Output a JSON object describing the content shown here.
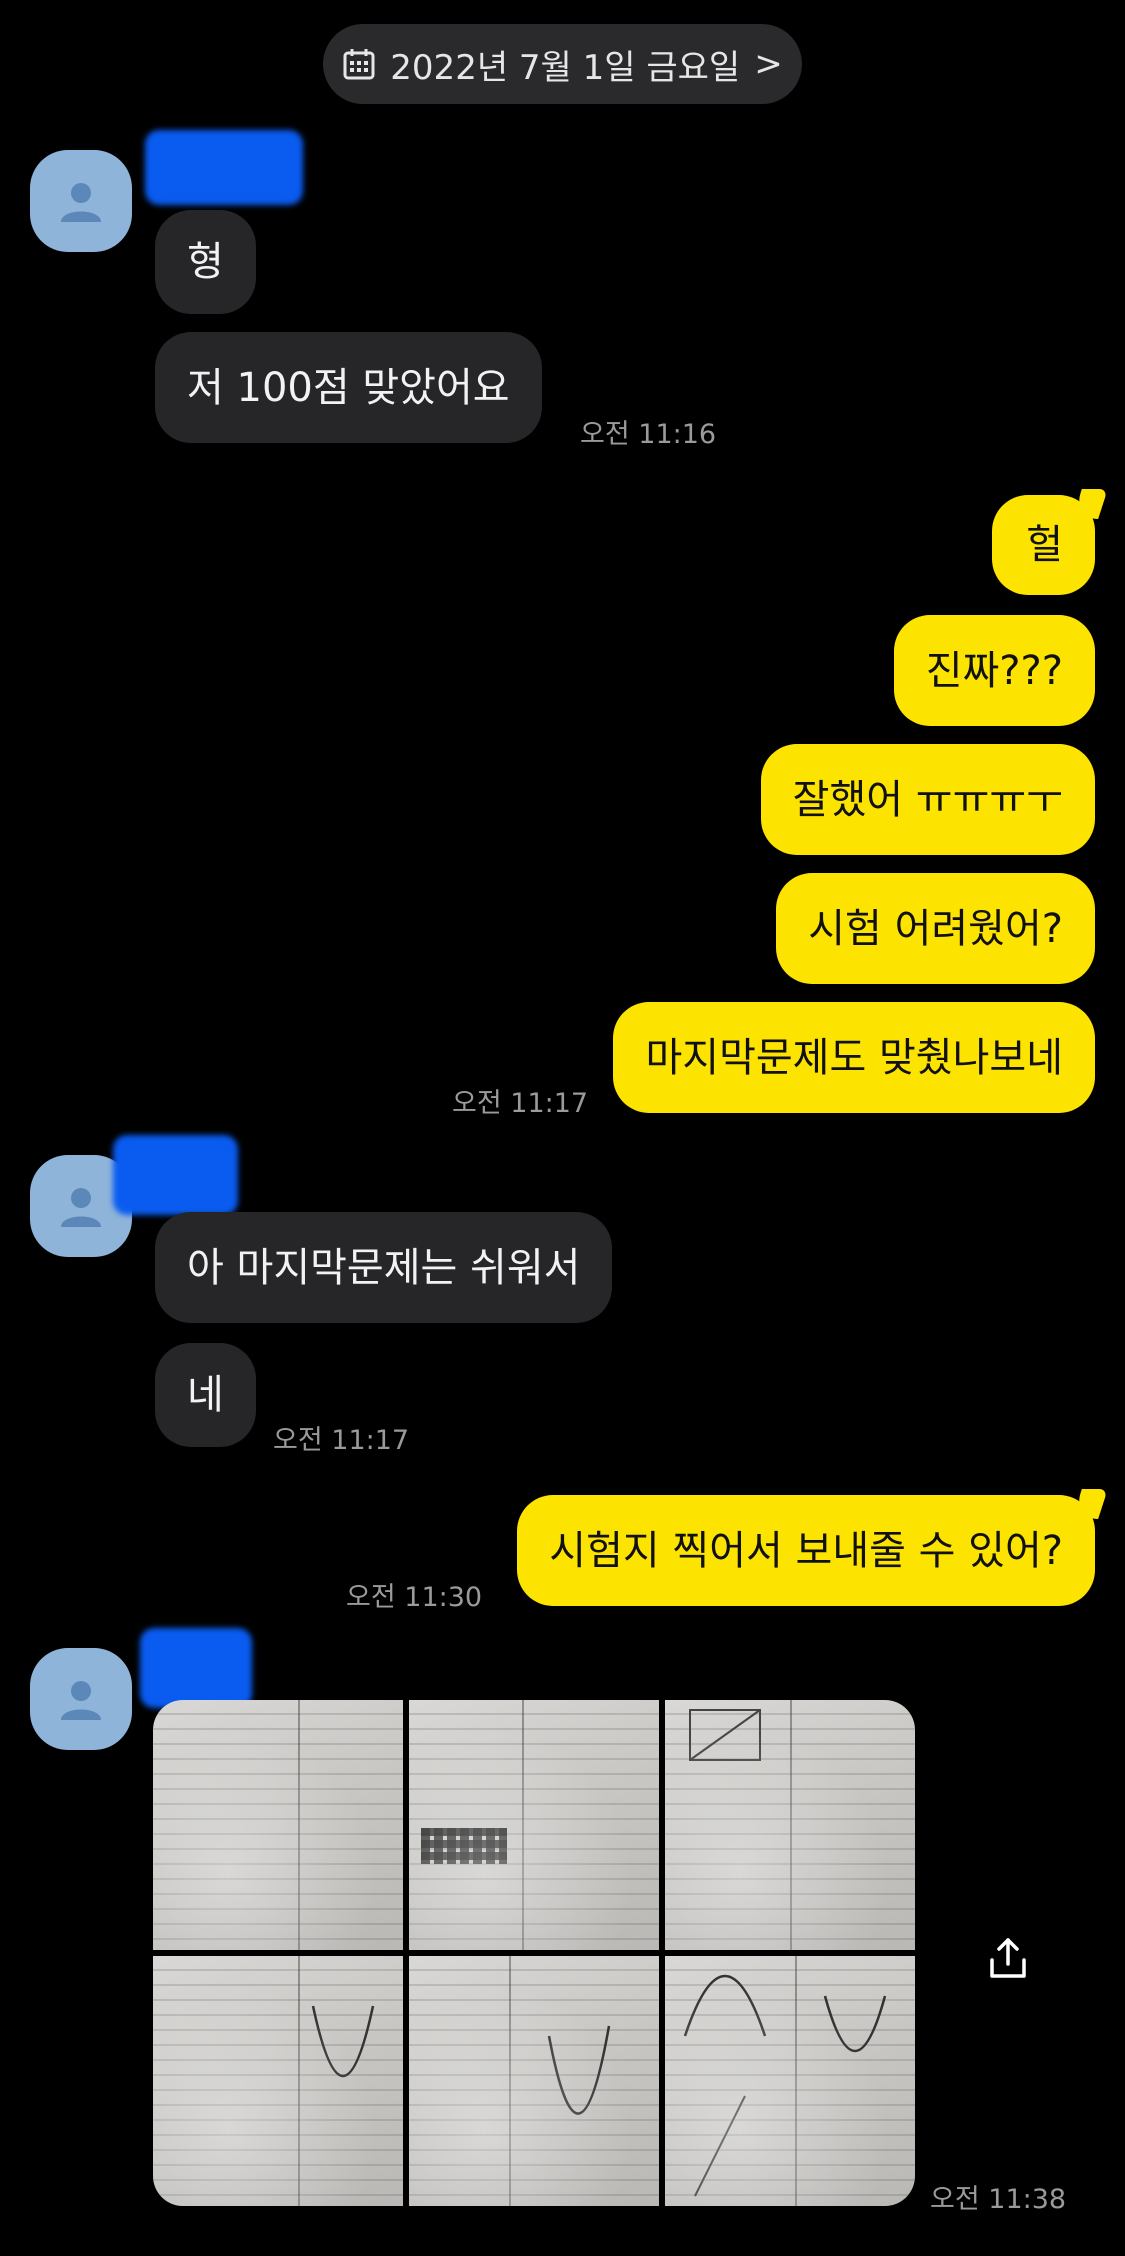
{
  "date_header": {
    "label": "2022년 7월 1일 금요일",
    "chevron": ">"
  },
  "icons": {
    "calendar": "calendar-icon",
    "chevron": "chevron-right-icon",
    "avatar": "person-icon",
    "share": "share-icon"
  },
  "colors": {
    "background": "#000000",
    "incoming_bubble": "#262628",
    "outgoing_bubble": "#fde300",
    "avatar_bg": "#8fb4da",
    "redaction": "#0a5bf0"
  },
  "messages": {
    "in_1": "형",
    "in_2": "저 100점 맞았어요",
    "in_2_time": "오전 11:16",
    "out_1": "헐",
    "out_2": "진짜???",
    "out_3": "잘했어 ㅠㅠㅠㅜ",
    "out_4": "시험 어려웠어?",
    "out_5": "마지막문제도 맞췄나보네",
    "out_5_time": "오전 11:17",
    "in_3": "아 마지막문제는 쉬워서",
    "in_4": "네",
    "in_4_time": "오전 11:17",
    "out_6": "시험지 찍어서 보내줄 수 있어?",
    "out_6_time": "오전 11:30",
    "photos_time": "오전 11:38"
  }
}
